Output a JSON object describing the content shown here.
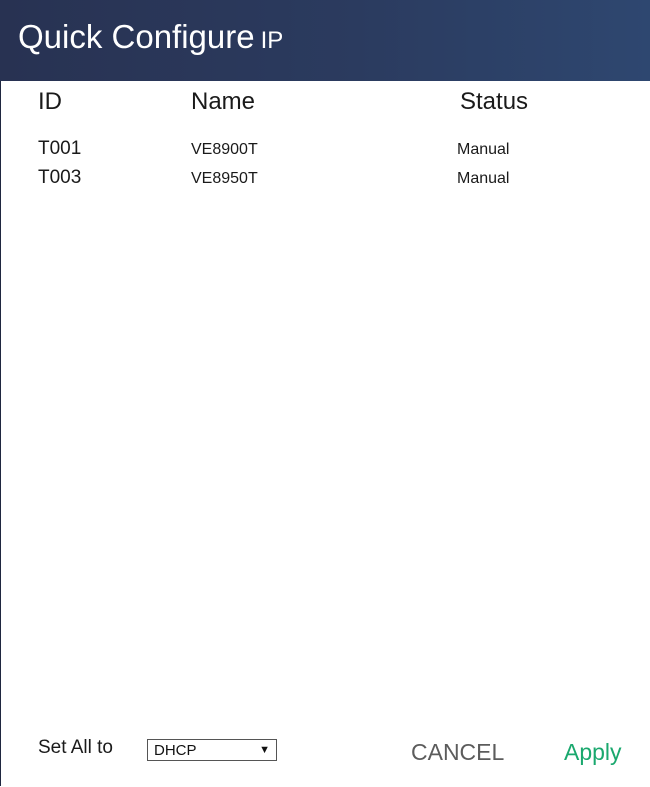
{
  "header": {
    "title": "Quick Configure",
    "title_suffix": "IP"
  },
  "table": {
    "columns": [
      "ID",
      "Name",
      "Status"
    ],
    "rows": [
      {
        "id": "T001",
        "name": "VE8900T",
        "status": "Manual"
      },
      {
        "id": "T003",
        "name": "VE8950T",
        "status": "Manual"
      }
    ]
  },
  "footer": {
    "set_all_label": "Set All to",
    "select_value": "DHCP",
    "cancel_label": "CANCEL",
    "apply_label": "Apply"
  },
  "colors": {
    "header_bg": "#2b3b5f",
    "apply": "#1aa86e",
    "cancel": "#5c5c5c"
  },
  "icons": {
    "dropdown": "caret-down-icon"
  }
}
